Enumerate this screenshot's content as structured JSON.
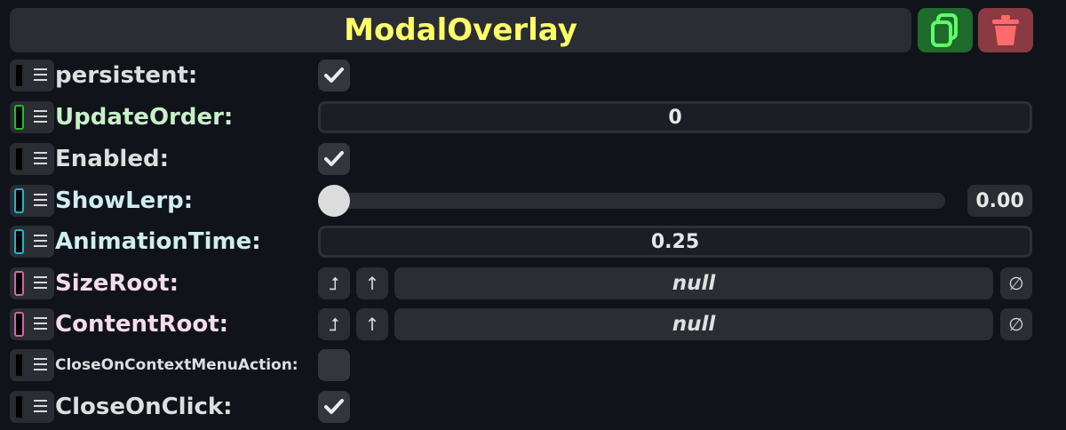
{
  "header": {
    "title": "ModalOverlay"
  },
  "buttons": {
    "duplicate_icon": "copy-icon",
    "delete_icon": "trash-icon"
  },
  "colors": {
    "title": "#ffff66",
    "label_default": "#dedede",
    "label_green": "#c8f0c8",
    "label_cyan": "#cfeef0",
    "label_pink": "#f3dde8",
    "duplicate_bg": "#1f6b2b",
    "delete_bg": "#8a3a40"
  },
  "rows": {
    "persistent": {
      "label": "persistent:",
      "checked": true
    },
    "update_order": {
      "label": "UpdateOrder:",
      "value": "0"
    },
    "enabled": {
      "label": "Enabled:",
      "checked": true
    },
    "show_lerp": {
      "label": "ShowLerp:",
      "value": "0.00"
    },
    "animation_time": {
      "label": "AnimationTime:",
      "value": "0.25"
    },
    "size_root": {
      "label": "SizeRoot:",
      "value": "null"
    },
    "content_root": {
      "label": "ContentRoot:",
      "value": "null"
    },
    "close_on_context": {
      "label": "CloseOnContextMenuAction:",
      "checked": false
    },
    "close_on_click": {
      "label": "CloseOnClick:",
      "checked": true
    }
  },
  "ref_buttons": {
    "jump_glyph": "⮥",
    "up_glyph": "↑",
    "clear_glyph": "∅"
  }
}
